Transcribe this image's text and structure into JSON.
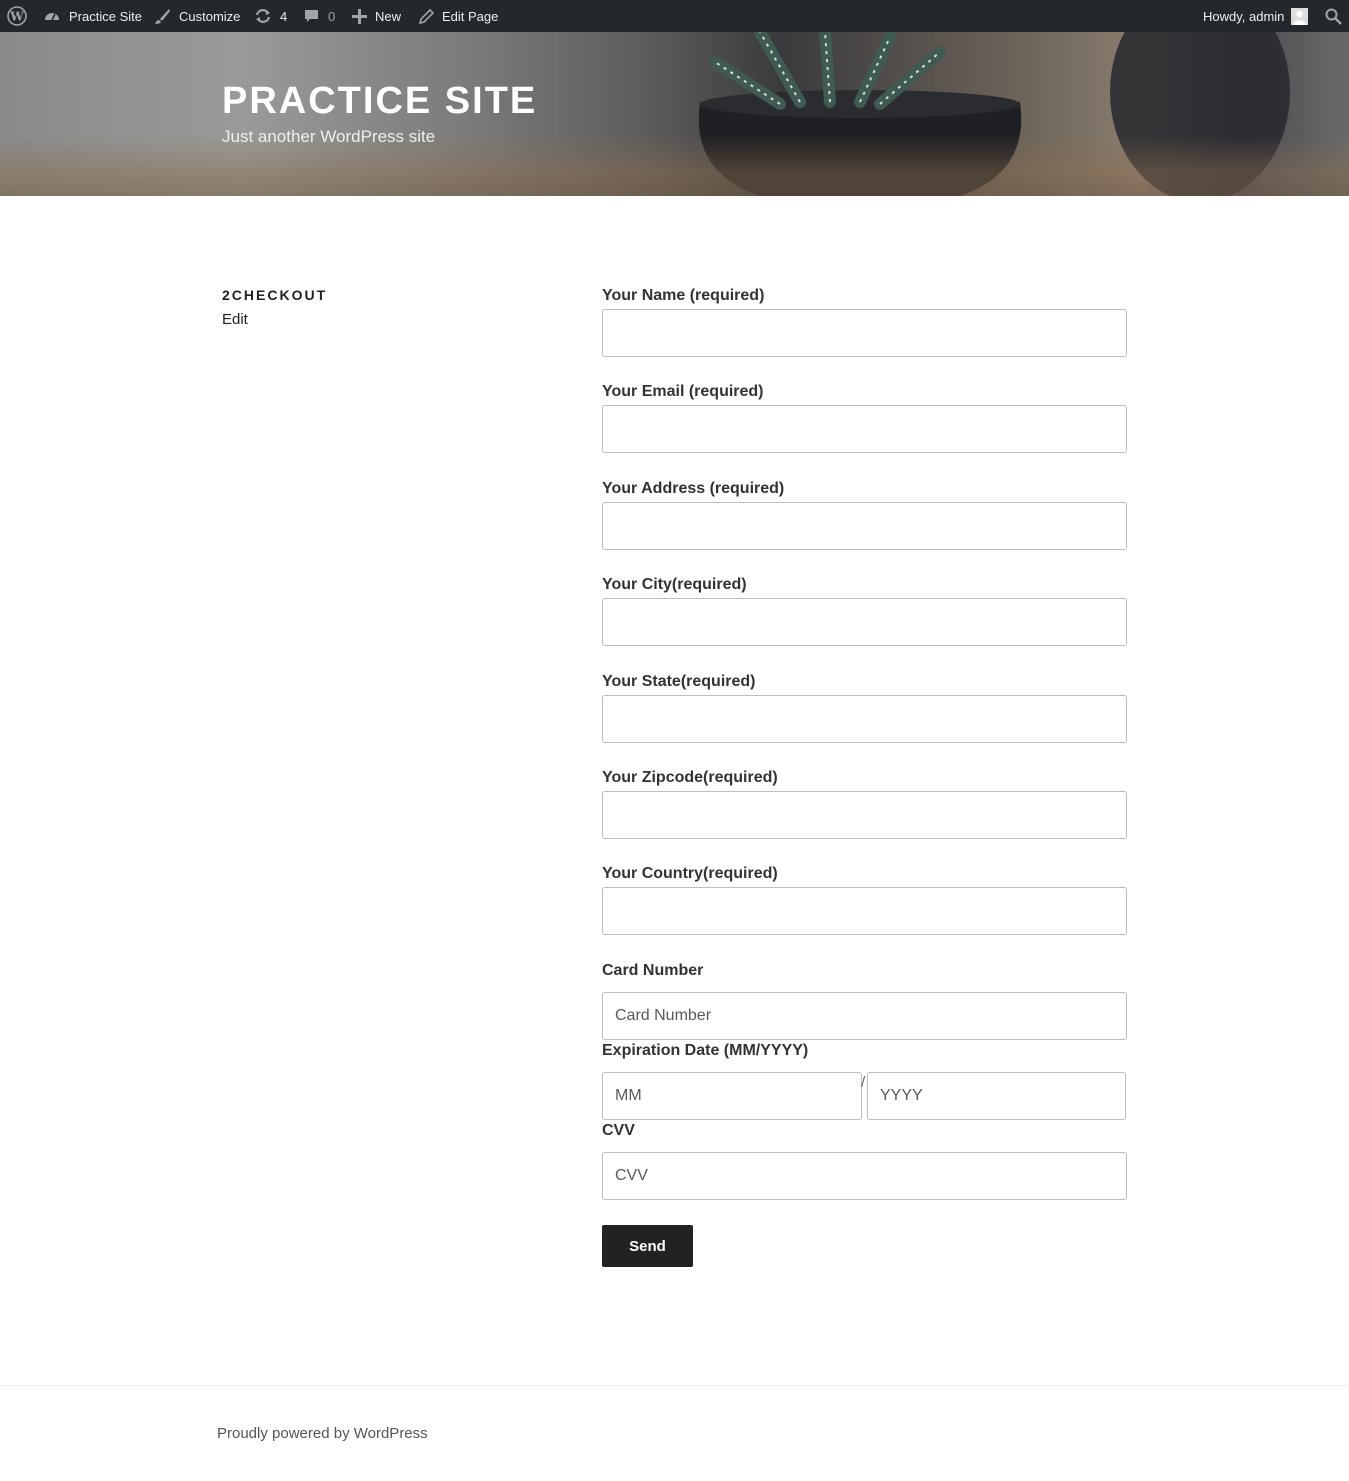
{
  "adminbar": {
    "site_name": "Practice Site",
    "customize": "Customize",
    "updates_count": "4",
    "comments_count": "0",
    "new_label": "New",
    "edit_page": "Edit Page",
    "howdy": "Howdy, admin"
  },
  "header": {
    "title": "PRACTICE SITE",
    "description": "Just another WordPress site"
  },
  "page": {
    "title": "2CHECKOUT",
    "edit": "Edit"
  },
  "form": {
    "name_label": "Your Name (required)",
    "email_label": "Your Email (required)",
    "address_label": "Your Address (required)",
    "city_label": "Your City(required)",
    "state_label": "Your State(required)",
    "zip_label": "Your Zipcode(required)",
    "country_label": "Your Country(required)",
    "card_label": "Card Number",
    "card_placeholder": "Card Number",
    "expiry_label": "Expiration Date (MM/YYYY)",
    "month_placeholder": "MM",
    "separator": "/",
    "year_placeholder": "YYYY",
    "cvv_label": "CVV",
    "cvv_placeholder": "CVV",
    "submit": "Send"
  },
  "footer": {
    "text": "Proudly powered by WordPress"
  }
}
